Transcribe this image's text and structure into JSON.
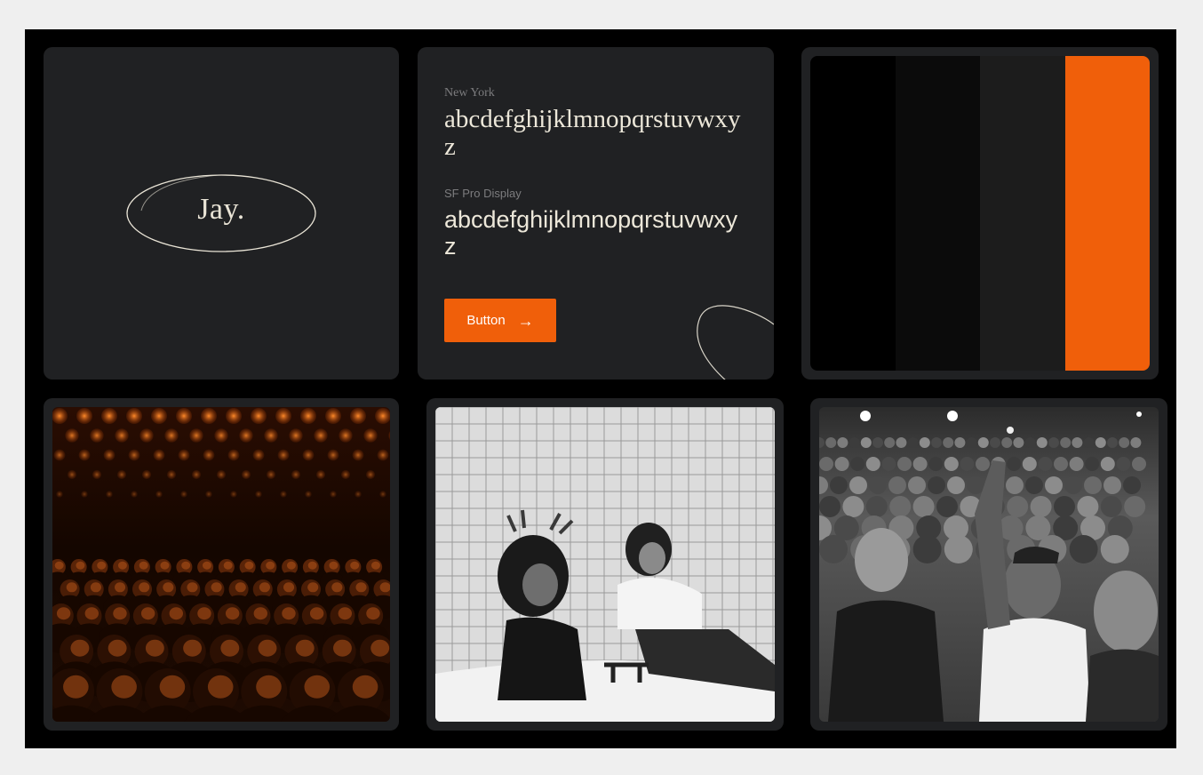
{
  "logo": {
    "text": "Jay."
  },
  "typography": {
    "serif_font_label": "New York",
    "serif_sample": "abcdefghijklmnopqrstuvwxyz",
    "sans_font_label": "SF Pro Display",
    "sans_sample": "abcdefghijklmnopqrstuvwxyz",
    "button_label": "Button",
    "button_icon": "arrow-right-icon"
  },
  "palette": {
    "colors": [
      "#000000",
      "#0b0b0b",
      "#1c1c1c",
      "#f05f0a"
    ]
  },
  "photos": [
    {
      "name": "audience-orange-tinted-photo",
      "tint": "#f05f0a"
    },
    {
      "name": "women-in-tiled-bathroom-photo",
      "tint": "#ffffff"
    },
    {
      "name": "concert-crowd-photo",
      "tint": "#ffffff"
    }
  ],
  "colors": {
    "accent": "#f05f0a",
    "card": "#202123",
    "board": "#000000",
    "text": "#ece7d9"
  }
}
